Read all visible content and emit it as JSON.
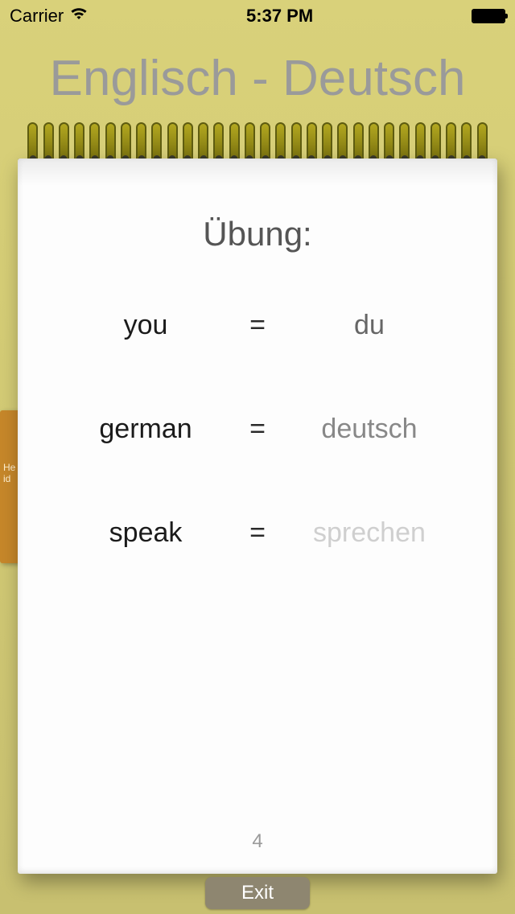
{
  "statusbar": {
    "carrier": "Carrier",
    "time": "5:37 PM"
  },
  "header": {
    "title": "Englisch - Deutsch"
  },
  "sticker": {
    "line1": "He",
    "line2": "id"
  },
  "exercise": {
    "heading": "Übung:",
    "page_number": "4",
    "pairs": [
      {
        "left": "you",
        "eq": "=",
        "right": "du",
        "tone": "ans-dark"
      },
      {
        "left": "german",
        "eq": "=",
        "right": "deutsch",
        "tone": "ans-mid"
      },
      {
        "left": "speak",
        "eq": "=",
        "right": "sprechen",
        "tone": "ans-light"
      }
    ]
  },
  "controls": {
    "exit_label": "Exit"
  }
}
